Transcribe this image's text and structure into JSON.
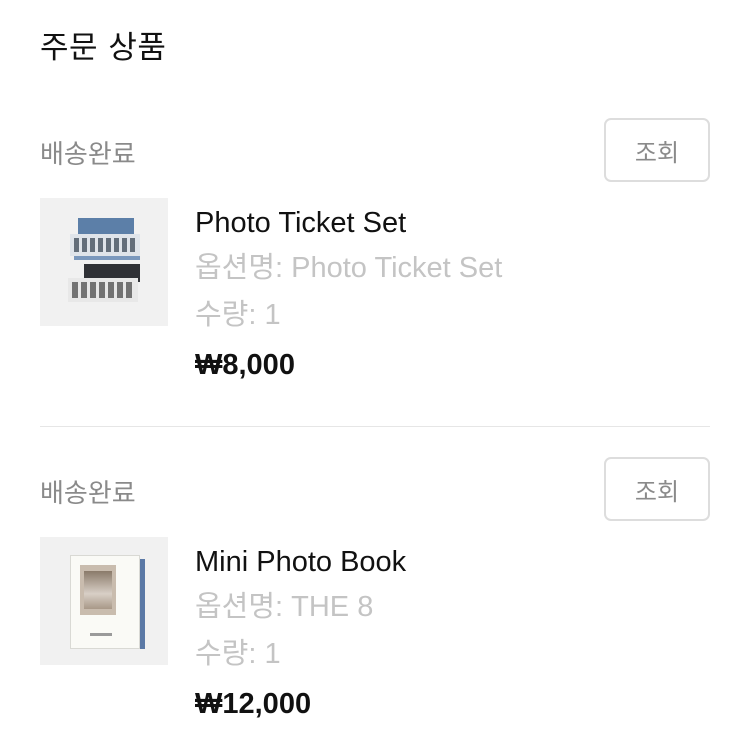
{
  "header": {
    "title": "주문 상품"
  },
  "orders": [
    {
      "status": "배송완료",
      "lookup_label": "조회",
      "name": "Photo Ticket Set",
      "option": "옵션명: Photo Ticket Set",
      "quantity": "수량: 1",
      "price": "₩8,000"
    },
    {
      "status": "배송완료",
      "lookup_label": "조회",
      "name": "Mini Photo Book",
      "option": "옵션명: THE 8",
      "quantity": "수량: 1",
      "price": "₩12,000"
    }
  ]
}
